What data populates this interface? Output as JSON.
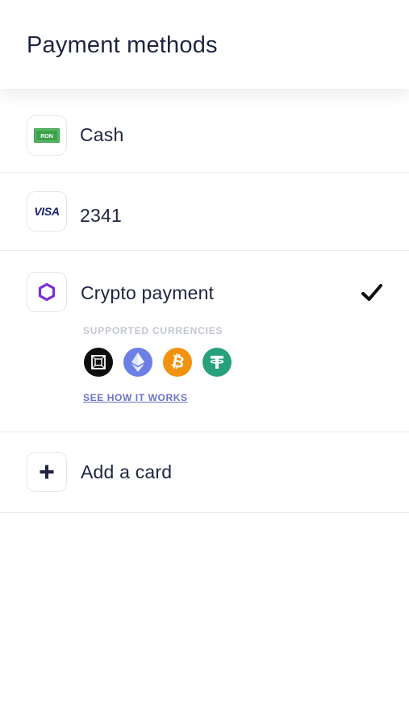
{
  "header": {
    "title": "Payment methods"
  },
  "methods": {
    "cash": {
      "label": "Cash",
      "badge_text": "RON",
      "icon": "cash-banknote-icon"
    },
    "visa": {
      "label": "2341",
      "brand_text": "VISA",
      "icon": "visa-card-icon"
    },
    "crypto": {
      "label": "Crypto payment",
      "icon": "crypto-hexagon-icon",
      "selected": true,
      "supported_label": "SUPPORTED CURRENCIES",
      "currencies": [
        {
          "icon": "bitcoin-cash-like-square-icon",
          "color": "#0d0d0d"
        },
        {
          "icon": "ethereum-icon",
          "color": "#6c7fe5"
        },
        {
          "icon": "bitcoin-icon",
          "color": "#f2930f"
        },
        {
          "icon": "tether-icon",
          "color": "#26a17b"
        }
      ],
      "link_label": "SEE HOW IT WORKS"
    },
    "add_card": {
      "label": "Add a card",
      "icon": "plus-icon"
    }
  },
  "colors": {
    "text": "#1d2540",
    "accent_purple": "#7b2fd6",
    "cash_green": "#3aa24a",
    "visa_navy": "#1a1f71",
    "link": "#6a73c6"
  }
}
